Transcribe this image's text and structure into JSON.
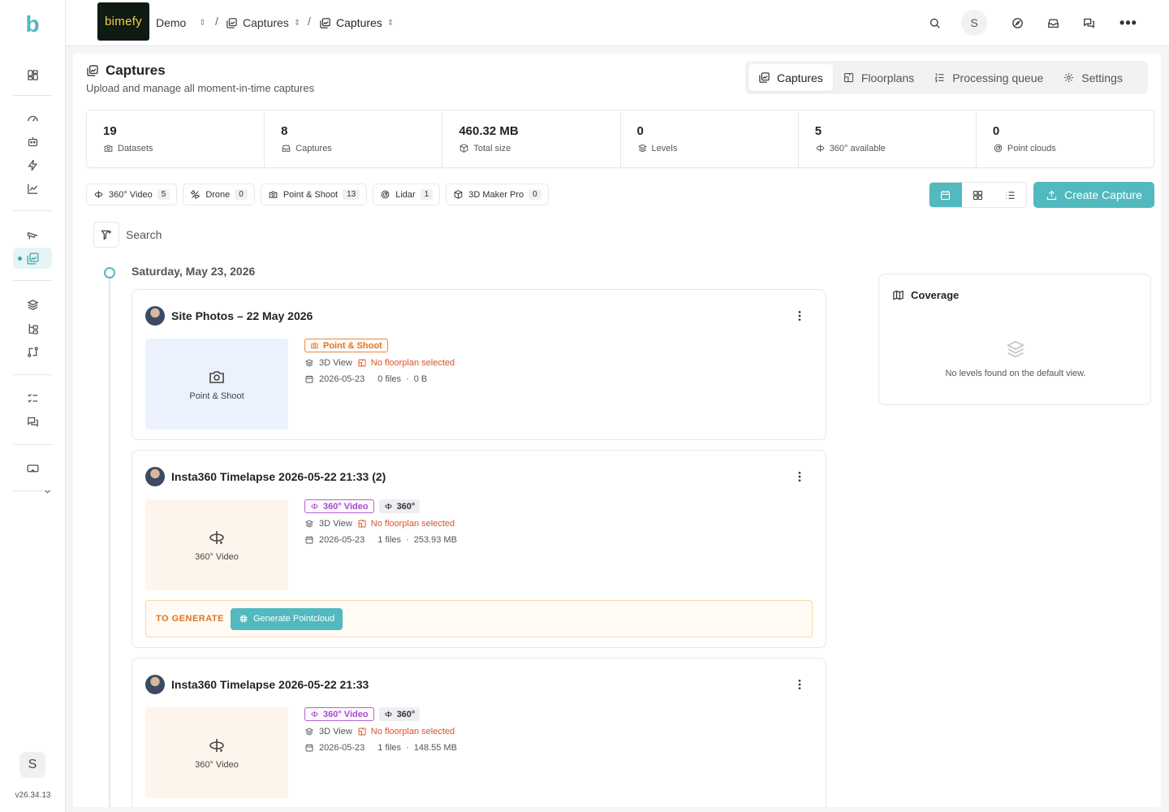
{
  "rail": {
    "logo": "b",
    "avatar_initial": "S",
    "version": "v26.34.13"
  },
  "topbar": {
    "brand": "bimefy",
    "project": "Demo",
    "crumb1": "Captures",
    "crumb2": "Captures",
    "user_initial": "S"
  },
  "page": {
    "title": "Captures",
    "subtitle": "Upload and manage all moment-in-time captures",
    "tabs": [
      {
        "label": "Captures"
      },
      {
        "label": "Floorplans"
      },
      {
        "label": "Processing queue"
      },
      {
        "label": "Settings"
      }
    ]
  },
  "stats": [
    {
      "value": "19",
      "label": "Datasets"
    },
    {
      "value": "8",
      "label": "Captures"
    },
    {
      "value": "460.32 MB",
      "label": "Total size"
    },
    {
      "value": "0",
      "label": "Levels"
    },
    {
      "value": "5",
      "label": "360° available"
    },
    {
      "value": "0",
      "label": "Point clouds"
    }
  ],
  "chips": [
    {
      "label": "360° Video",
      "count": "5"
    },
    {
      "label": "Drone",
      "count": "0"
    },
    {
      "label": "Point & Shoot",
      "count": "13"
    },
    {
      "label": "Lidar",
      "count": "1"
    },
    {
      "label": "3D Maker Pro",
      "count": "0"
    }
  ],
  "create_label": "Create Capture",
  "search": {
    "placeholder": "Search"
  },
  "timeline": {
    "date": "Saturday, May 23, 2026"
  },
  "cards": [
    {
      "title": "Site Photos – 22 May 2026",
      "thumb_label": "Point & Shoot",
      "tag": "Point & Shoot",
      "view": "3D View",
      "floorplan": "No floorplan selected",
      "date": "2026-05-23",
      "files": "0 files",
      "size": "0 B"
    },
    {
      "title": "Insta360 Timelapse 2026-05-22 21:33 (2)",
      "thumb_label": "360° Video",
      "tag": "360° Video",
      "tag2": "360°",
      "view": "3D View",
      "floorplan": "No floorplan selected",
      "date": "2026-05-23",
      "files": "1 files",
      "size": "253.93 MB",
      "gen_label": "TO GENERATE",
      "gen_button": "Generate Pointcloud"
    },
    {
      "title": "Insta360 Timelapse 2026-05-22 21:33",
      "thumb_label": "360° Video",
      "tag": "360° Video",
      "tag2": "360°",
      "view": "3D View",
      "floorplan": "No floorplan selected",
      "date": "2026-05-23",
      "files": "1 files",
      "size": "148.55 MB"
    }
  ],
  "coverage": {
    "title": "Coverage",
    "empty": "No levels found on the default view."
  },
  "colors": {
    "accent": "#52b9be",
    "warning": "#d9532a",
    "point_shoot": "#d9752a",
    "video360": "#a34cc8"
  }
}
